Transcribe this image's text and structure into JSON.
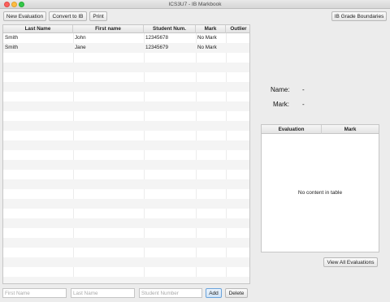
{
  "window": {
    "title": "ICS3U7 - IB Markbook"
  },
  "toolbar": {
    "new_evaluation": "New Evaluation",
    "convert_to_ib": "Convert to IB",
    "print": "Print",
    "ib_grade_boundaries": "IB Grade Boundaries"
  },
  "students_table": {
    "columns": [
      "Last Name",
      "First name",
      "Student Num.",
      "Mark",
      "Outlier"
    ],
    "rows": [
      [
        "Smith",
        "John",
        "12345678",
        "No Mark",
        ""
      ],
      [
        "Smith",
        "Jane",
        "12345679",
        "No Mark",
        ""
      ]
    ]
  },
  "add_form": {
    "first_name_placeholder": "First Name",
    "last_name_placeholder": "Last Name",
    "student_number_placeholder": "Student Number",
    "add_label": "Add",
    "delete_label": "Delete"
  },
  "details": {
    "name_label": "Name:",
    "name_value": "-",
    "mark_label": "Mark:",
    "mark_value": "-"
  },
  "evaluations_table": {
    "columns": [
      "Evaluation",
      "Mark"
    ],
    "empty_text": "No content in table",
    "view_all_label": "View All Evaluations"
  }
}
